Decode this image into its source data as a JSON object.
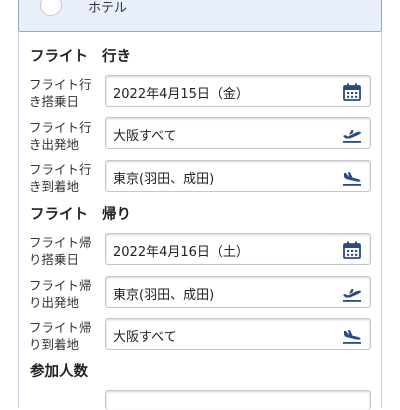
{
  "hotel_option": {
    "label": "ホテル"
  },
  "outbound": {
    "title_a": "フライト",
    "title_b": "行き",
    "fields": [
      {
        "label_l1": "フライト行",
        "label_l2": "き搭乗日",
        "value": "2022年4月15日（金）",
        "icon": "calendar-icon"
      },
      {
        "label_l1": "フライト行",
        "label_l2": "き出発地",
        "value": "大阪すべて",
        "icon": "plane-departure-icon"
      },
      {
        "label_l1": "フライト行",
        "label_l2": "き到着地",
        "value": "東京(羽田、成田)",
        "icon": "plane-arrival-icon"
      }
    ]
  },
  "return": {
    "title_a": "フライト",
    "title_b": "帰り",
    "fields": [
      {
        "label_l1": "フライト帰",
        "label_l2": "り搭乗日",
        "value": "2022年4月16日（土）",
        "icon": "calendar-icon"
      },
      {
        "label_l1": "フライト帰",
        "label_l2": "り出発地",
        "value": "東京(羽田、成田)",
        "icon": "plane-departure-icon"
      },
      {
        "label_l1": "フライト帰",
        "label_l2": "り到着地",
        "value": "大阪すべて",
        "icon": "plane-arrival-icon"
      }
    ]
  },
  "participants": {
    "title": "参加人数"
  },
  "colors": {
    "icon": "#2a4a88",
    "accent_bg": "#e8effb",
    "accent_border": "#8fa6cf"
  }
}
